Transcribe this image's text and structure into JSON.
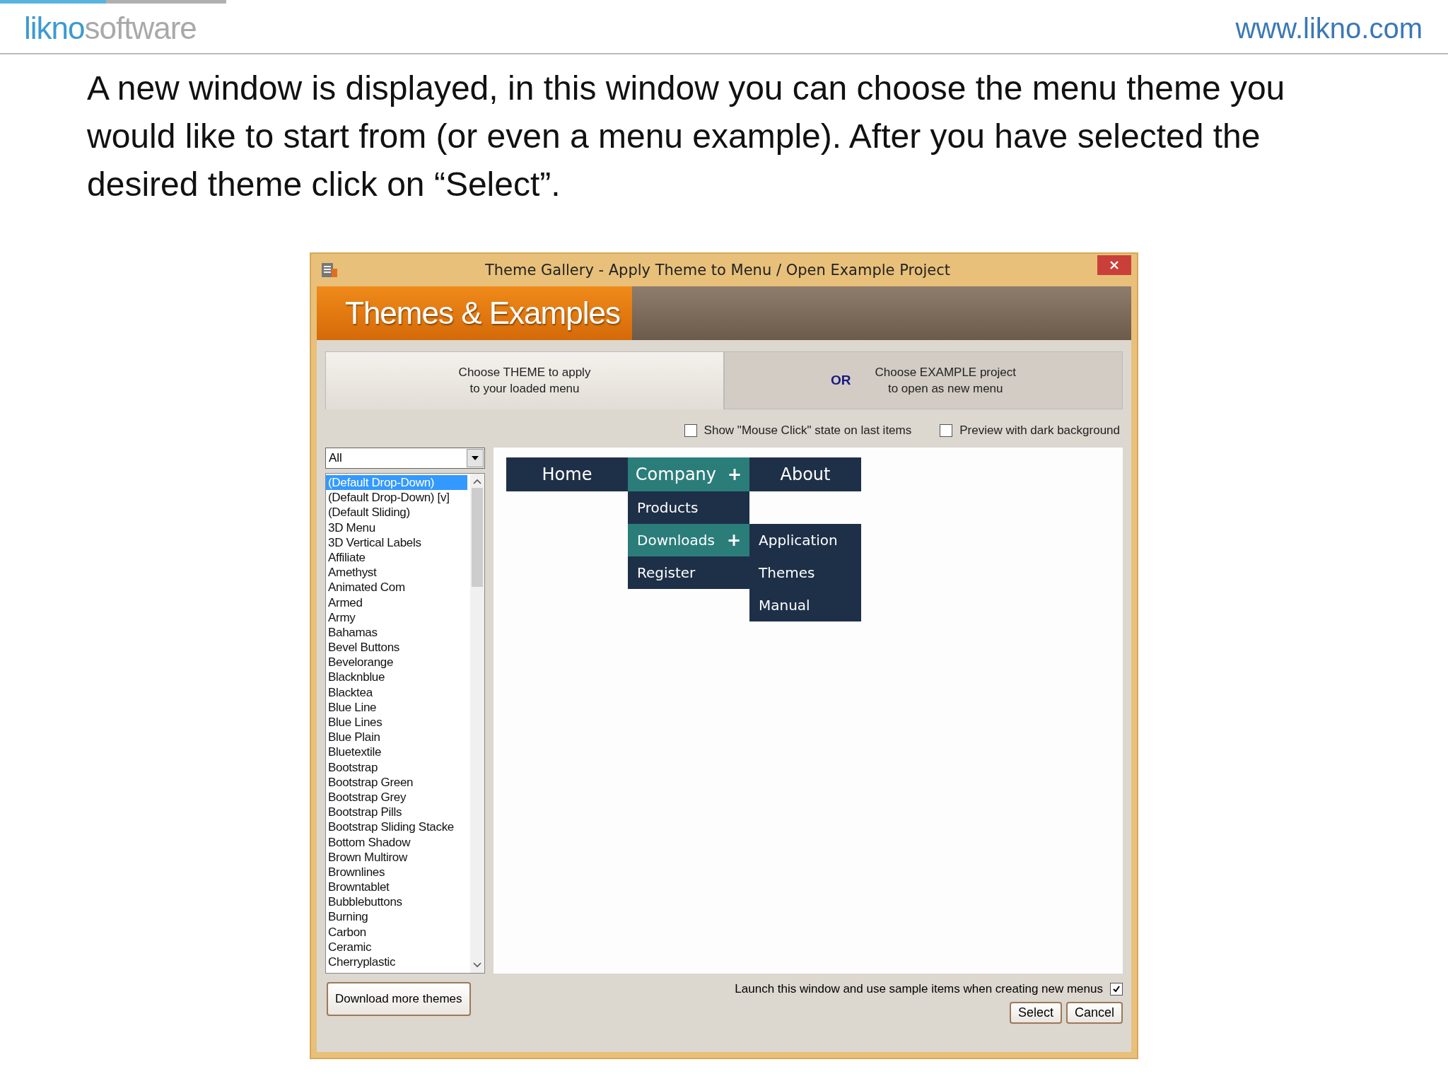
{
  "header": {
    "logo": {
      "first": "likno",
      "second": "software"
    },
    "url": "www.likno.com"
  },
  "instruction": "A new window is displayed, in this window you can choose the menu theme you would like to start from (or even a menu example). After you have selected the desired theme click on “Select”.",
  "dialog": {
    "title": "Theme Gallery - Apply Theme to Menu / Open Example Project",
    "banner": "Themes & Examples",
    "tabs": [
      {
        "lines": [
          "Choose THEME to apply",
          "to your loaded menu"
        ],
        "selected": true
      },
      {
        "prefix": "OR",
        "lines": [
          "Choose EXAMPLE project",
          "to open as new menu"
        ],
        "selected": false
      }
    ],
    "options": [
      {
        "label": "Show \"Mouse Click\" state on last items",
        "checked": false
      },
      {
        "label": "Preview with dark background",
        "checked": false
      }
    ],
    "filter": {
      "value": "All"
    },
    "themes": [
      {
        "label": "(Default Drop-Down)",
        "selected": true
      },
      {
        "label": "(Default Drop-Down) [v]",
        "selected": false
      },
      {
        "label": "(Default Sliding)",
        "selected": false
      },
      {
        "label": "3D Menu",
        "selected": false
      },
      {
        "label": "3D Vertical Labels",
        "selected": false
      },
      {
        "label": "Affiliate",
        "selected": false
      },
      {
        "label": "Amethyst",
        "selected": false
      },
      {
        "label": "Animated Com",
        "selected": false
      },
      {
        "label": "Armed",
        "selected": false
      },
      {
        "label": "Army",
        "selected": false
      },
      {
        "label": "Bahamas",
        "selected": false
      },
      {
        "label": "Bevel Buttons",
        "selected": false
      },
      {
        "label": "Bevelorange",
        "selected": false
      },
      {
        "label": "Blacknblue",
        "selected": false
      },
      {
        "label": "Blacktea",
        "selected": false
      },
      {
        "label": "Blue Line",
        "selected": false
      },
      {
        "label": "Blue Lines",
        "selected": false
      },
      {
        "label": "Blue Plain",
        "selected": false
      },
      {
        "label": "Bluetextile",
        "selected": false
      },
      {
        "label": "Bootstrap",
        "selected": false
      },
      {
        "label": "Bootstrap Green",
        "selected": false
      },
      {
        "label": "Bootstrap Grey",
        "selected": false
      },
      {
        "label": "Bootstrap Pills",
        "selected": false
      },
      {
        "label": "Bootstrap Sliding Stacke",
        "selected": false
      },
      {
        "label": "Bottom Shadow",
        "selected": false
      },
      {
        "label": "Brown Multirow",
        "selected": false
      },
      {
        "label": "Brownlines",
        "selected": false
      },
      {
        "label": "Browntablet",
        "selected": false
      },
      {
        "label": "Bubblebuttons",
        "selected": false
      },
      {
        "label": "Burning",
        "selected": false
      },
      {
        "label": "Carbon",
        "selected": false
      },
      {
        "label": "Ceramic",
        "selected": false
      },
      {
        "label": "Cherryplastic",
        "selected": false
      }
    ],
    "preview_menu": [
      {
        "label": "Home",
        "selected": false
      },
      {
        "label": "Company",
        "selected": true,
        "expander": "+",
        "children": [
          {
            "label": "Products",
            "selected": false
          },
          {
            "label": "Downloads",
            "selected": true,
            "expander": "+",
            "children": [
              {
                "label": "Application",
                "selected": false
              },
              {
                "label": "Themes",
                "selected": false
              },
              {
                "label": "Manual",
                "selected": false
              }
            ]
          },
          {
            "label": "Register",
            "selected": false
          }
        ]
      },
      {
        "label": "About",
        "selected": false
      }
    ],
    "download_button": "Download more themes",
    "launch_option": {
      "label": "Launch this window and use sample items when creating new menus",
      "checked": true
    },
    "buttons": [
      "Select",
      "Cancel"
    ]
  }
}
